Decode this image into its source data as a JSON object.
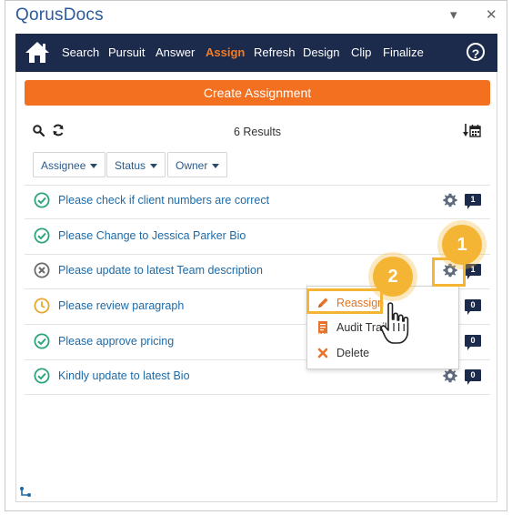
{
  "app": {
    "title": "QorusDocs",
    "pin_glyph": "▾",
    "close_glyph": "✕"
  },
  "nav": {
    "items": [
      "Search",
      "Pursuit",
      "Answer",
      "Assign",
      "Refresh",
      "Design",
      "Clip",
      "Finalize"
    ],
    "active": "Assign",
    "help_glyph": "?"
  },
  "create_button": "Create Assignment",
  "results_text": "6 Results",
  "filters": [
    "Assignee",
    "Status",
    "Owner"
  ],
  "tasks": [
    {
      "label": "Please check if client numbers are correct",
      "status": "complete",
      "comments": "1",
      "gear": true
    },
    {
      "label": "Please Change to Jessica Parker Bio",
      "status": "complete",
      "comments": "",
      "gear": false
    },
    {
      "label": "Please update to latest Team description",
      "status": "rejected",
      "comments": "1",
      "gear": true
    },
    {
      "label": "Please review paragraph",
      "status": "pending",
      "comments": "0",
      "gear": false
    },
    {
      "label": "Please approve pricing",
      "status": "complete",
      "comments": "0",
      "gear": false
    },
    {
      "label": "Kindly update to latest Bio",
      "status": "complete",
      "comments": "0",
      "gear": true
    }
  ],
  "context_menu": {
    "items": [
      "Reassign",
      "Audit Trail",
      "Delete"
    ]
  },
  "callouts": [
    "1",
    "2"
  ],
  "colors": {
    "nav_bg": "#1c2b4c",
    "accent_orange": "#f37021",
    "link_blue": "#1d6aa7",
    "complete_green": "#2aa57a",
    "pending_amber": "#e6a82a",
    "rejected_gray": "#6a6a6a",
    "callout_yellow": "#f4b434"
  }
}
